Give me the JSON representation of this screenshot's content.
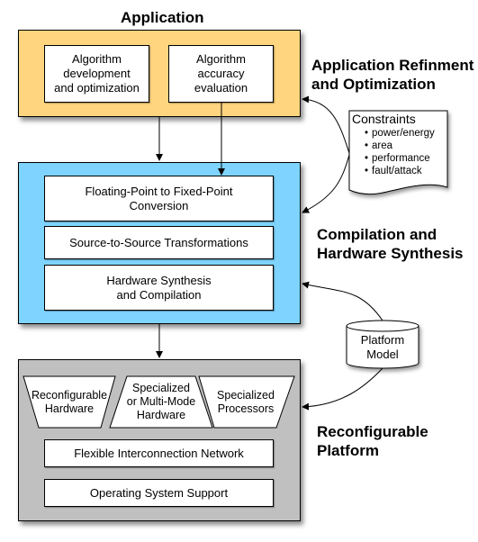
{
  "colors": {
    "application_fill": "#FFD57F",
    "compilation_fill": "#7FD4FF",
    "platform_fill": "#C0C0C0",
    "box_fill": "#FFFFFF",
    "stroke": "#000000"
  },
  "application": {
    "title": "Application",
    "boxes": [
      {
        "label": "Algorithm\ndevelopment\nand optimization"
      },
      {
        "label": "Algorithm\naccuracy\nevaluation"
      }
    ]
  },
  "compilation": {
    "boxes": [
      {
        "label": "Floating-Point to Fixed-Point\nConversion"
      },
      {
        "label": "Source-to-Source Transformations"
      },
      {
        "label": "Hardware Synthesis\nand Compilation"
      }
    ]
  },
  "platform": {
    "trapezoids": [
      {
        "label": "Reconfigurable\nHardware"
      },
      {
        "label": "Specialized\nor Multi-Mode\nHardware"
      },
      {
        "label": "Specialized\nProcessors"
      }
    ],
    "boxes": [
      {
        "label": "Flexible Interconnection Network"
      },
      {
        "label": "Operating System Support"
      }
    ]
  },
  "side_labels": {
    "refinement": "Application Refinment\nand Optimization",
    "compilation": "Compilation and\nHardware Synthesis",
    "platform": "Reconfigurable\nPlatform"
  },
  "constraints": {
    "title": "Constraints",
    "items": [
      "power/energy",
      "area",
      "performance",
      "fault/attack"
    ]
  },
  "platform_model": {
    "label": "Platform\nModel"
  }
}
